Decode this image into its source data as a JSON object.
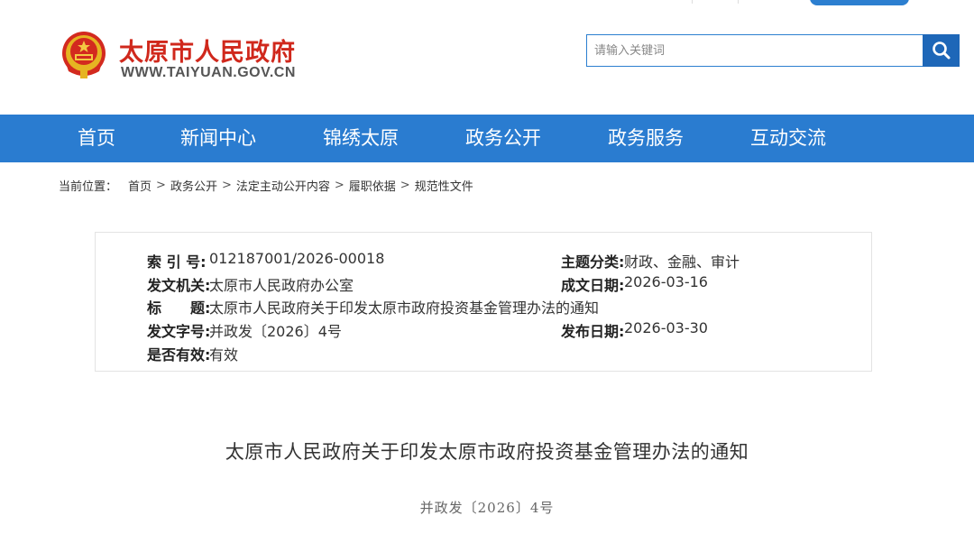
{
  "header": {
    "site_title": "太原市人民政府",
    "site_url": "WWW.TAIYUAN.GOV.CN",
    "search_placeholder": "请输入关键词"
  },
  "nav": {
    "items": [
      "首页",
      "新闻中心",
      "锦绣太原",
      "政务公开",
      "政务服务",
      "互动交流"
    ]
  },
  "breadcrumb": {
    "label": "当前位置：",
    "items": [
      "首页",
      "政务公开",
      "法定主动公开内容",
      "履职依据",
      "规范性文件"
    ],
    "separator": ">"
  },
  "info": {
    "index_label": "索 引 号:",
    "index_value": "012187001/2026-00018",
    "category_label": "主题分类:",
    "category_value": "财政、金融、审计",
    "issuer_label": "发文机关:",
    "issuer_value": "太原市人民政府办公室",
    "created_label": "成文日期:",
    "created_value": "2026-03-16",
    "title_label": "标　　题:",
    "title_value": "太原市人民政府关于印发太原市政府投资基金管理办法的通知",
    "docno_label": "发文字号:",
    "docno_value": "并政发〔2026〕4号",
    "published_label": "发布日期:",
    "published_value": "2026-03-30",
    "valid_label": "是否有效:",
    "valid_value": "有效"
  },
  "article": {
    "title": "太原市人民政府关于印发太原市政府投资基金管理办法的通知",
    "doc_number": "并政发〔2026〕4号"
  },
  "colors": {
    "brand_red": "#d0281c",
    "nav_blue": "#2a7cd0",
    "search_button_blue": "#1e67b8"
  }
}
